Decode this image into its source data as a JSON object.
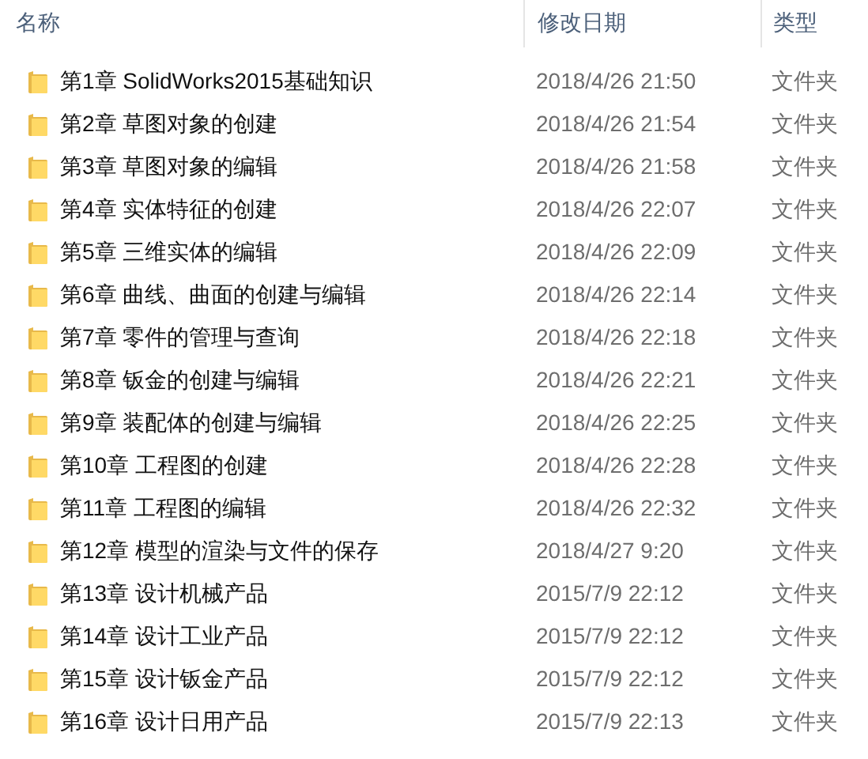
{
  "columns": [
    "名称",
    "修改日期",
    "类型"
  ],
  "rows": [
    {
      "name": "第1章 SolidWorks2015基础知识",
      "modified": "2018/4/26 21:50",
      "type": "文件夹"
    },
    {
      "name": "第2章 草图对象的创建",
      "modified": "2018/4/26 21:54",
      "type": "文件夹"
    },
    {
      "name": "第3章 草图对象的编辑",
      "modified": "2018/4/26 21:58",
      "type": "文件夹"
    },
    {
      "name": "第4章 实体特征的创建",
      "modified": "2018/4/26 22:07",
      "type": "文件夹"
    },
    {
      "name": "第5章 三维实体的编辑",
      "modified": "2018/4/26 22:09",
      "type": "文件夹"
    },
    {
      "name": "第6章 曲线、曲面的创建与编辑",
      "modified": "2018/4/26 22:14",
      "type": "文件夹"
    },
    {
      "name": "第7章 零件的管理与查询",
      "modified": "2018/4/26 22:18",
      "type": "文件夹"
    },
    {
      "name": "第8章 钣金的创建与编辑",
      "modified": "2018/4/26 22:21",
      "type": "文件夹"
    },
    {
      "name": "第9章 装配体的创建与编辑",
      "modified": "2018/4/26 22:25",
      "type": "文件夹"
    },
    {
      "name": "第10章 工程图的创建",
      "modified": "2018/4/26 22:28",
      "type": "文件夹"
    },
    {
      "name": "第11章 工程图的编辑",
      "modified": "2018/4/26 22:32",
      "type": "文件夹"
    },
    {
      "name": "第12章 模型的渲染与文件的保存",
      "modified": "2018/4/27 9:20",
      "type": "文件夹"
    },
    {
      "name": "第13章 设计机械产品",
      "modified": "2015/7/9 22:12",
      "type": "文件夹"
    },
    {
      "name": "第14章 设计工业产品",
      "modified": "2015/7/9 22:12",
      "type": "文件夹"
    },
    {
      "name": "第15章 设计钣金产品",
      "modified": "2015/7/9 22:12",
      "type": "文件夹"
    },
    {
      "name": "第16章 设计日用产品",
      "modified": "2015/7/9 22:13",
      "type": "文件夹"
    }
  ]
}
